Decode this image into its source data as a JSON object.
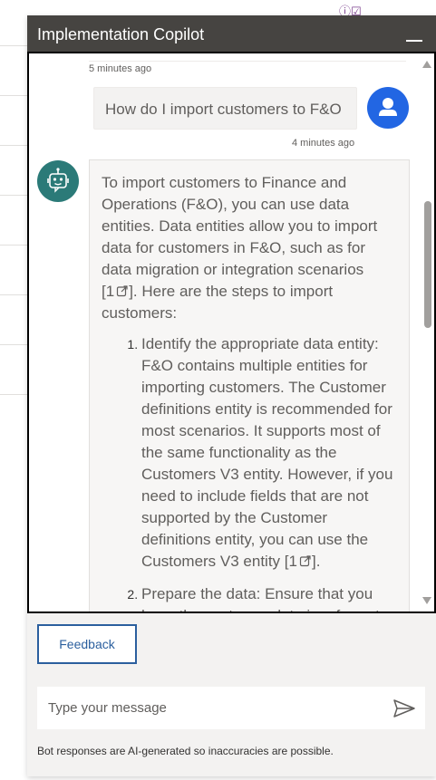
{
  "background": {
    "top_icons": "ⓘ☑"
  },
  "panel": {
    "title": "Implementation Copilot"
  },
  "messages": {
    "top_timestamp": "5 minutes ago",
    "user_message": "How do I import customers to F&O",
    "user_timestamp": "4 minutes ago",
    "bot_intro": "To import customers to Finance and Operations (F&O), you can use data entities. Data entities allow you to import data for customers in F&O, such as for data migration or integration scenarios",
    "bot_intro_citation": "[1",
    "bot_intro_citation_close": "].",
    "bot_intro_tail": "Here are the steps to import customers:",
    "steps": [
      {
        "text": "Identify the appropriate data entity: F&O contains multiple entities for importing customers. The Customer definitions entity is recommended for most scenarios. It supports most of the same functionality as the Customers V3 entity. However, if you need to include fields that are not supported by the Customer definitions entity, you can use the Customers V3 entity ",
        "citation": "[1",
        "citation_close": "]."
      },
      {
        "text": "Prepare the data: Ensure that you have the customer data in a format that is compatible with the selected"
      }
    ]
  },
  "feedback": {
    "label": "Feedback"
  },
  "input": {
    "placeholder": "Type your message"
  },
  "disclaimer": "Bot responses are AI-generated so inaccuracies are possible.",
  "colors": {
    "header_bg": "#464441",
    "user_avatar": "#2266e3",
    "bot_avatar": "#2b7a78",
    "feedback_border": "#2b5f9e"
  },
  "icons": {
    "minimize": "minimize-icon",
    "user": "user-icon",
    "bot": "bot-icon",
    "external_link": "external-link-icon",
    "send": "send-icon"
  }
}
